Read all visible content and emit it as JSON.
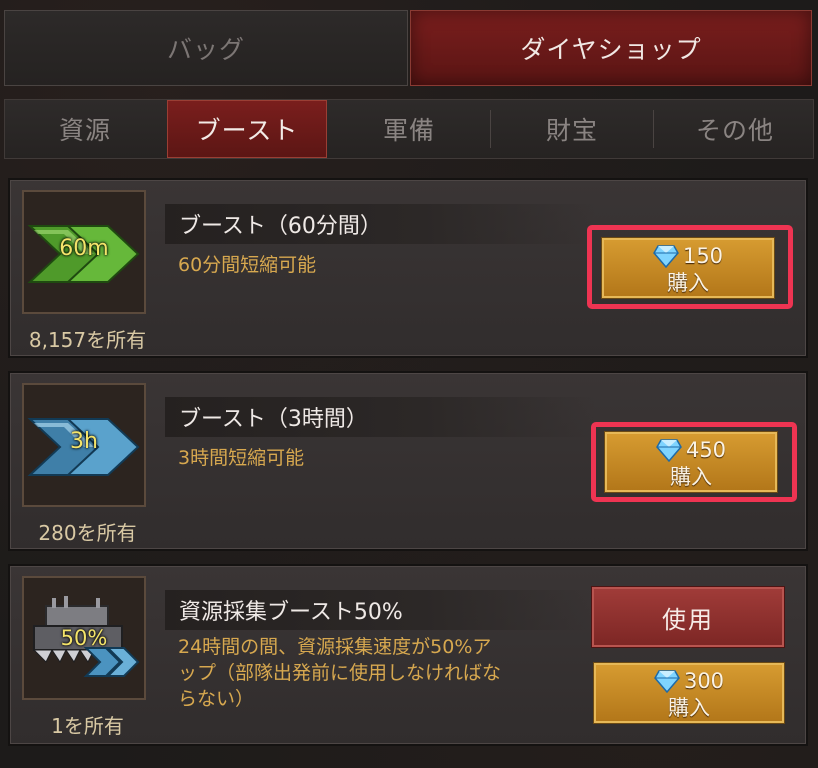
{
  "top_tabs": [
    {
      "label": "バッグ",
      "active": false
    },
    {
      "label": "ダイヤショップ",
      "active": true
    }
  ],
  "sub_tabs": [
    {
      "label": "資源",
      "active": false
    },
    {
      "label": "ブースト",
      "active": true
    },
    {
      "label": "軍備",
      "active": false
    },
    {
      "label": "財宝",
      "active": false
    },
    {
      "label": "その他",
      "active": false
    }
  ],
  "items": [
    {
      "icon_text": "60m",
      "icon": "green-double-chevron-icon",
      "owned": "8,157を所有",
      "title": "ブースト（60分間）",
      "desc": "60分間短縮可能",
      "price": "150",
      "buy_label": "購入",
      "highlighted": true
    },
    {
      "icon_text": "3h",
      "icon": "blue-double-chevron-icon",
      "owned": "280を所有",
      "title": "ブースト（3時間）",
      "desc": "3時間短縮可能",
      "price": "450",
      "buy_label": "購入",
      "highlighted": true
    },
    {
      "icon_text": "50%",
      "icon": "gathering-truck-icon",
      "owned": "1を所有",
      "title": "資源採集ブースト50%",
      "desc_lines": [
        "24時間の間、資源採集速度が50%ア",
        "ップ（部隊出発前に使用しなければな",
        "らない）"
      ],
      "use_label": "使用",
      "price": "300",
      "buy_label": "購入",
      "highlighted": false
    }
  ],
  "colors": {
    "accent_red": "#7a1e1d",
    "gold_button": "#d79c31",
    "highlight": "#ee3452",
    "desc_text": "#d7a84f"
  }
}
